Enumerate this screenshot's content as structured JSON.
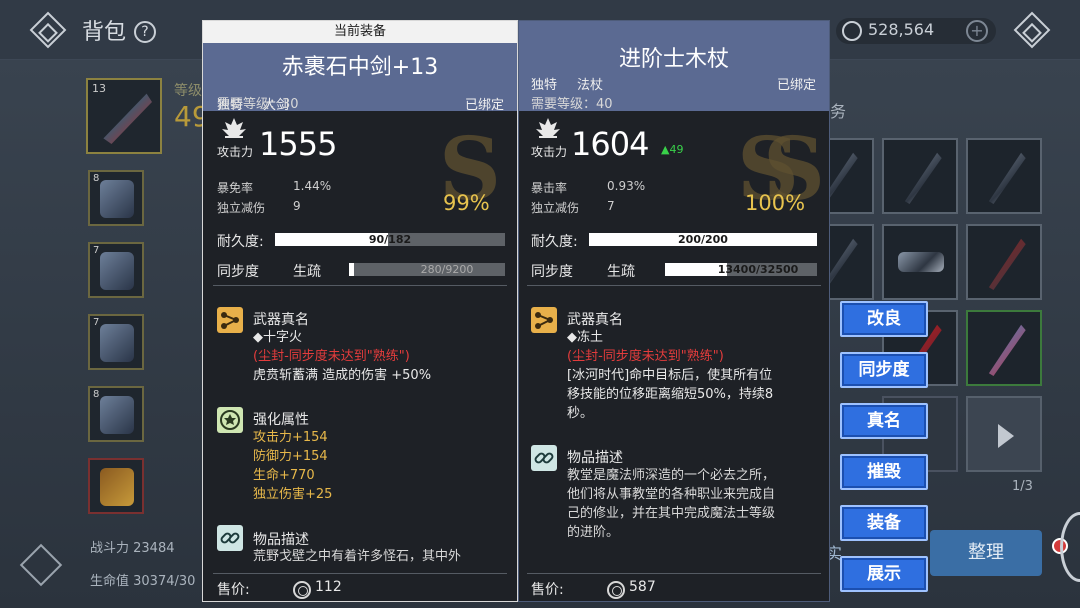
{
  "topbar": {
    "title": "背包",
    "help": "?",
    "coins": "528,564",
    "add": "+"
  },
  "bag": {
    "selected_count": "13",
    "level_ghost": "等级",
    "level_ghost_num": "49",
    "slots": [
      {
        "count": "8"
      },
      {
        "count": "7"
      },
      {
        "count": "7"
      },
      {
        "count": "8"
      },
      {
        "count": ""
      }
    ],
    "power": "战斗力 23484",
    "hp": "生命值 30374/30",
    "task_ghost": "务",
    "page": "1/3",
    "sort_ghost": "实",
    "sort": "整理"
  },
  "current": {
    "tab": "当前装备",
    "name": "赤裹石中剑+13",
    "rarity": "独特",
    "type": "大剑",
    "bound": "已绑定",
    "req_level": "需要等级：30",
    "atk_label": "攻击力",
    "atk": "1555",
    "crit_label": "暴免率",
    "crit": "1.44%",
    "indep_label": "独立减伤",
    "indep": "9",
    "grade": "S",
    "percent": "99%",
    "durability_label": "耐久度:",
    "durability_text": "90/182",
    "durability_ratio": 0.49,
    "sync_label": "同步度",
    "sync_state": "生疏",
    "sync_text": "280/9200",
    "sync_ratio": 0.03,
    "true_name_title": "武器真名",
    "true_name": "◆十字火",
    "sealed": "(尘封-同步度未达到\"熟练\")",
    "true_name_effect": "虎贲斩蓄满 造成的伤害 +50%",
    "enhance_title": "强化属性",
    "enhance": [
      "攻击力+154",
      "防御力+154",
      "生命+770",
      "独立伤害+25"
    ],
    "desc_title": "物品描述",
    "desc": "荒野戈壁之中有着许多怪石，其中外",
    "price_label": "售价:",
    "price": "112"
  },
  "compare": {
    "name": "进阶士木杖",
    "rarity": "独特",
    "type": "法杖",
    "bound": "已绑定",
    "req_level": "需要等级：40",
    "atk_label": "攻击力",
    "atk": "1604",
    "atk_diff": "▲49",
    "crit_label": "暴击率",
    "crit": "0.93%",
    "indep_label": "独立减伤",
    "indep": "7",
    "grade": "S",
    "percent": "100%",
    "durability_label": "耐久度:",
    "durability_text": "200/200",
    "durability_ratio": 1.0,
    "sync_label": "同步度",
    "sync_state": "生疏",
    "sync_text": "13400/32500",
    "sync_ratio": 0.41,
    "true_name_title": "武器真名",
    "true_name": "◆冻土",
    "sealed": "(尘封-同步度未达到\"熟练\")",
    "true_name_effect": [
      "[冰河时代]命中目标后，使其所有位",
      "移技能的位移距离缩短50%，持续8",
      "秒。"
    ],
    "desc_title": "物品描述",
    "desc": [
      "教堂是魔法师深造的一个必去之所，",
      "他们将从事教堂的各种职业来完成自",
      "己的修业，并在其中完成魔法士等级",
      "的进阶。"
    ],
    "price_label": "售价:",
    "price": "587"
  },
  "actions": {
    "improve": "改良",
    "sync": "同步度",
    "true_name": "真名",
    "destroy": "摧毁",
    "equip": "装备",
    "show": "展示"
  },
  "colors": {
    "header": "#5b6a92",
    "accent_gold": "#e7c34e",
    "sealed_red": "#e33c3c",
    "button_blue": "#2f6fe0",
    "up_green": "#39d24a"
  }
}
